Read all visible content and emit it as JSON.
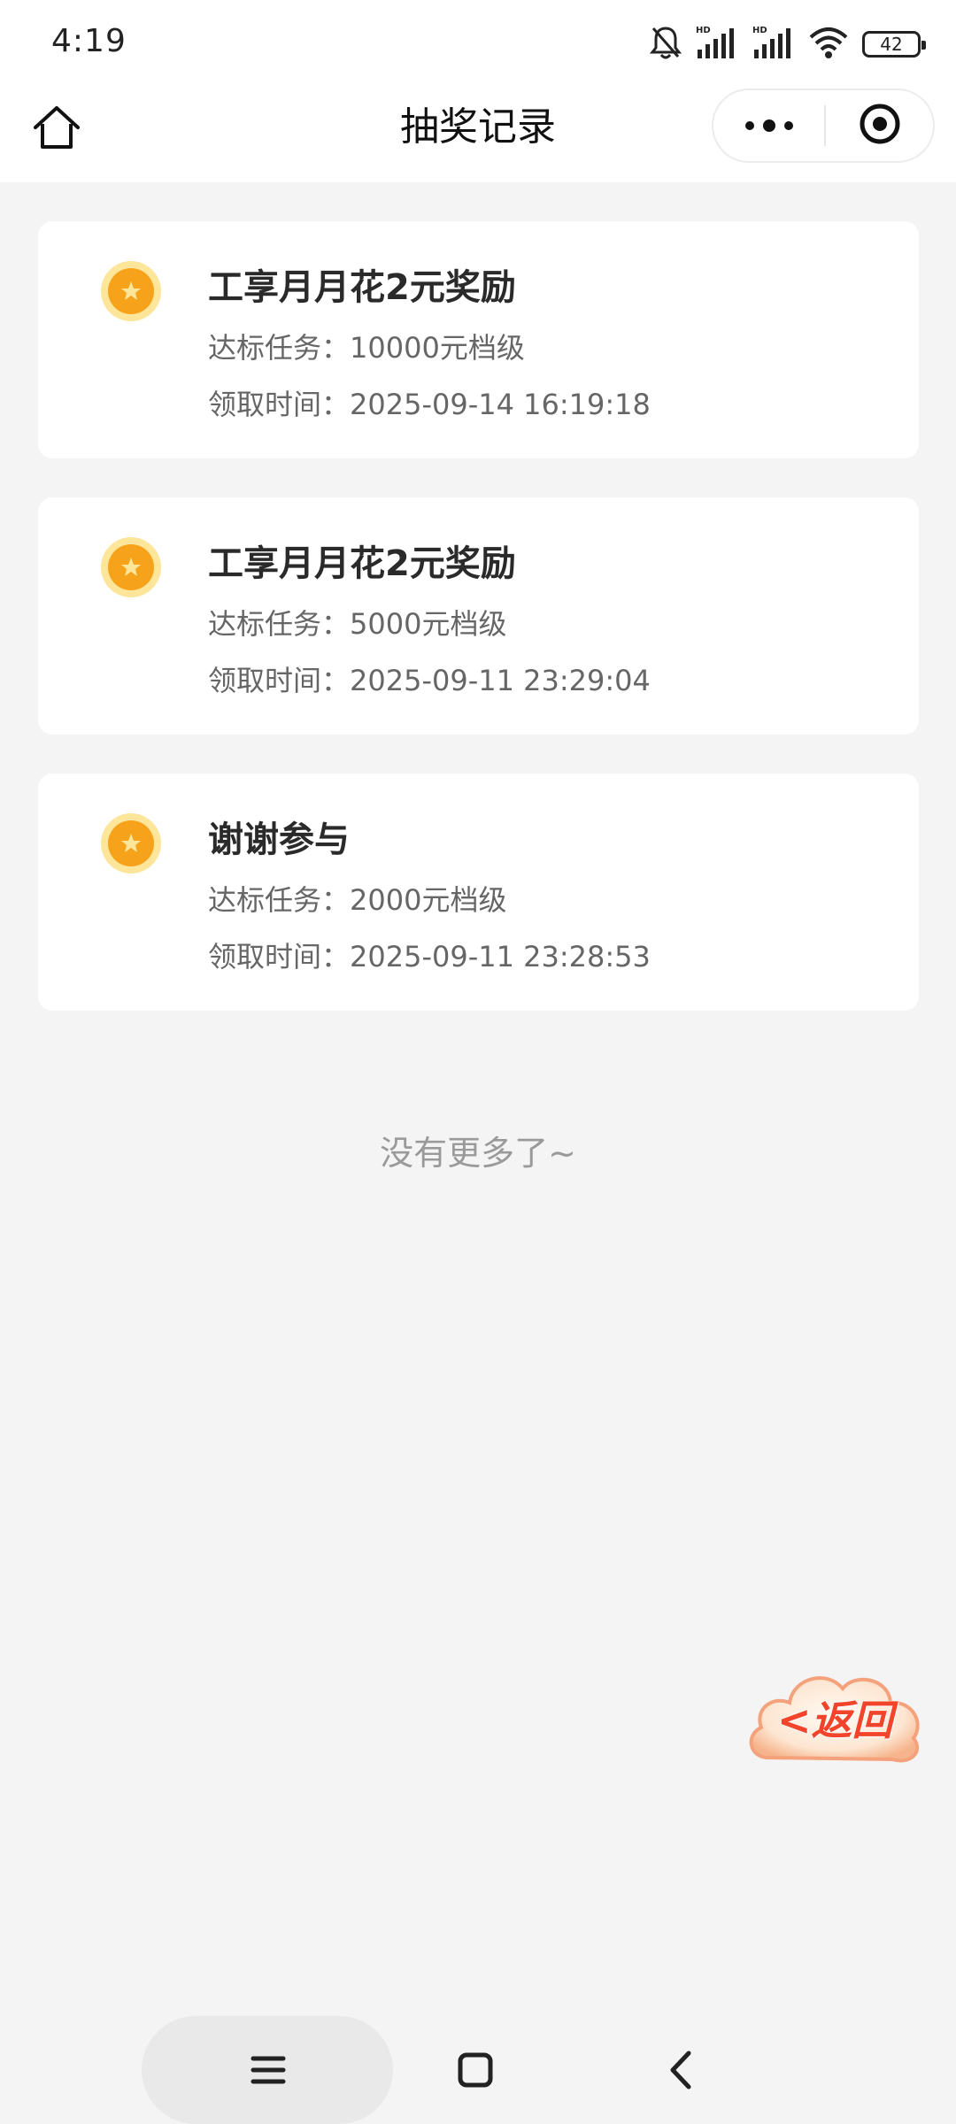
{
  "status_bar": {
    "time": "4:19",
    "battery": "42",
    "icons": [
      "bell-muted-icon",
      "hd-signal-icon",
      "hd-signal-icon",
      "wifi-icon",
      "battery-icon"
    ]
  },
  "nav": {
    "title": "抽奖记录",
    "home_icon": "home-icon",
    "more_icon": "more-dots-icon",
    "close_icon": "target-close-icon"
  },
  "records": [
    {
      "title": "工享月月花2元奖励",
      "task_label": "达标任务：",
      "task_value": "10000元档级",
      "time_label": "领取时间：",
      "time_value": "2025-09-14 16:19:18"
    },
    {
      "title": "工享月月花2元奖励",
      "task_label": "达标任务：",
      "task_value": "5000元档级",
      "time_label": "领取时间：",
      "time_value": "2025-09-11 23:29:04"
    },
    {
      "title": "谢谢参与",
      "task_label": "达标任务：",
      "task_value": "2000元档级",
      "time_label": "领取时间：",
      "time_value": "2025-09-11 23:28:53"
    }
  ],
  "footer": {
    "no_more": "没有更多了~"
  },
  "float_back": {
    "label": "<返回"
  },
  "colors": {
    "accent_orange": "#f7a21b",
    "medal_ring": "#fde59a",
    "back_red": "#f2432b",
    "page_bg": "#f4f4f4"
  }
}
